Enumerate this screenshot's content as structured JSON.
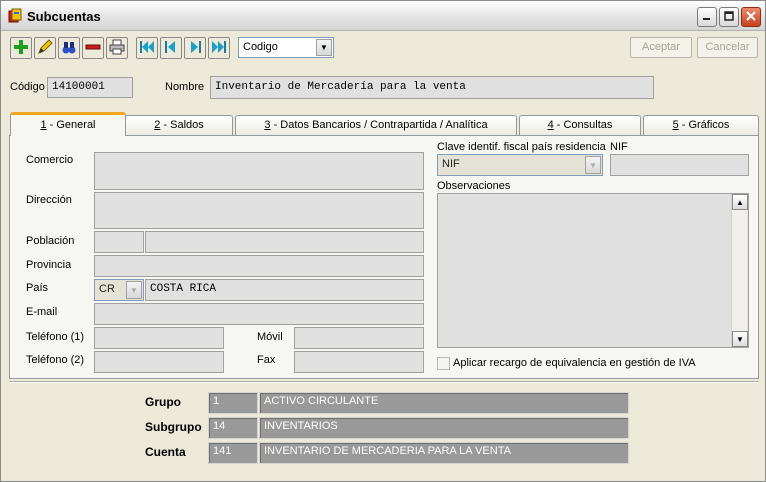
{
  "window": {
    "title": "Subcuentas",
    "icons": {
      "app": "app-book-icon",
      "minimize": "minimize-icon",
      "maximize": "maximize-icon",
      "close": "close-icon"
    }
  },
  "toolbar": {
    "buttons": [
      {
        "name": "add-button",
        "icon": "plus-icon"
      },
      {
        "name": "edit-button",
        "icon": "pencil-icon"
      },
      {
        "name": "search-button",
        "icon": "binoculars-icon"
      },
      {
        "name": "delete-button",
        "icon": "minus-icon"
      },
      {
        "name": "print-button",
        "icon": "printer-icon"
      },
      {
        "name": "first-record-button",
        "icon": "first-icon"
      },
      {
        "name": "prev-record-button",
        "icon": "prev-icon"
      },
      {
        "name": "next-record-button",
        "icon": "next-icon"
      },
      {
        "name": "last-record-button",
        "icon": "last-icon"
      }
    ],
    "order_select": "Codigo",
    "accept_label": "Aceptar",
    "cancel_label": "Cancelar"
  },
  "header": {
    "code_label": "Código",
    "code_value": "14100001",
    "name_label": "Nombre",
    "name_value": "Inventario de Mercadería para la venta"
  },
  "tabs": [
    {
      "key": "1",
      "label": " - General"
    },
    {
      "key": "2",
      "label": " - Saldos"
    },
    {
      "key": "3",
      "label": " - Datos Bancarios / Contrapartida / Analítica"
    },
    {
      "key": "4",
      "label": " - Consultas"
    },
    {
      "key": "5",
      "label": " - Gráficos"
    }
  ],
  "general": {
    "comercio_label": "Comercio",
    "direccion_label": "Dirección",
    "poblacion_label": "Población",
    "provincia_label": "Provincia",
    "pais_label": "País",
    "pais_code": "CR",
    "pais_name": "COSTA RICA",
    "email_label": "E-mail",
    "telefono1_label": "Teléfono (1)",
    "telefono2_label": "Teléfono (2)",
    "movil_label": "Móvil",
    "fax_label": "Fax",
    "clave_label": "Clave identif. fiscal país residencia",
    "clave_value": "NIF",
    "nif_label": "NIF",
    "observaciones_label": "Observaciones",
    "recargo_label": "Aplicar recargo de equivalencia en gestión de IVA",
    "recargo_checked": false
  },
  "classification": {
    "grupo_label": "Grupo",
    "grupo_code": "1",
    "grupo_name": "ACTIVO CIRCULANTE",
    "subgrupo_label": "Subgrupo",
    "subgrupo_code": "14",
    "subgrupo_name": "INVENTARIOS",
    "cuenta_label": "Cuenta",
    "cuenta_code": "141",
    "cuenta_name": "INVENTARIO DE MERCADERIA PARA LA VENTA"
  }
}
